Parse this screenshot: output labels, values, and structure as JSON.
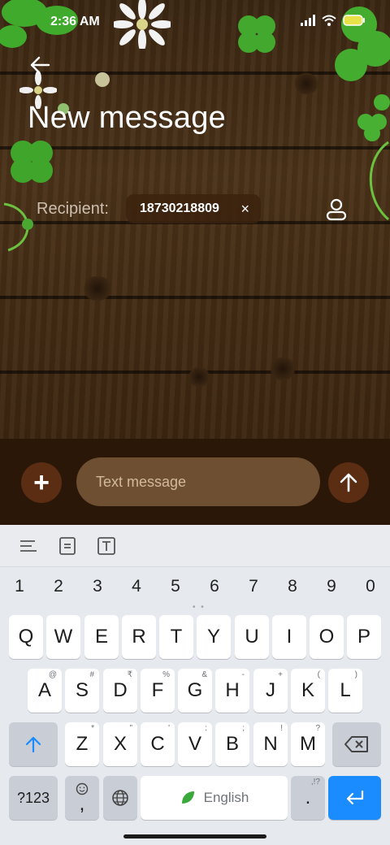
{
  "status_bar": {
    "time": "2:36 AM",
    "battery_color": "#e8e24a"
  },
  "header": {
    "title": "New message",
    "back_icon": "arrow-left-icon"
  },
  "recipient": {
    "label": "Recipient:",
    "chip_value": "18730218809",
    "chip_remove": "×",
    "contacts_icon": "person-icon"
  },
  "composer": {
    "add_label": "+",
    "placeholder": "Text message",
    "send_icon": "arrow-up-icon"
  },
  "keyboard": {
    "toolbar": [
      "menu-lines-icon",
      "clipboard-icon",
      "text-format-icon"
    ],
    "numbers": [
      "1",
      "2",
      "3",
      "4",
      "5",
      "6",
      "7",
      "8",
      "9",
      "0"
    ],
    "row1": [
      "Q",
      "W",
      "E",
      "R",
      "T",
      "Y",
      "U",
      "I",
      "O",
      "P"
    ],
    "row2": [
      "A",
      "S",
      "D",
      "F",
      "G",
      "H",
      "J",
      "K",
      "L"
    ],
    "row2_hints": [
      "@",
      "#",
      "₹",
      "%",
      "&",
      "-",
      "+",
      "(",
      ")"
    ],
    "row3": [
      "Z",
      "X",
      "C",
      "V",
      "B",
      "N",
      "M"
    ],
    "row3_hints": [
      "*",
      "\"",
      "'",
      ":",
      ";",
      "!",
      "?"
    ],
    "symbols_label": "?123",
    "comma_label": ",",
    "space_label": "English",
    "period_label": ".",
    "period_hint": ",!?"
  },
  "colors": {
    "accent": "#1a8cff",
    "composer_bg": "#2a1708",
    "bubble": "#6e4f32"
  }
}
